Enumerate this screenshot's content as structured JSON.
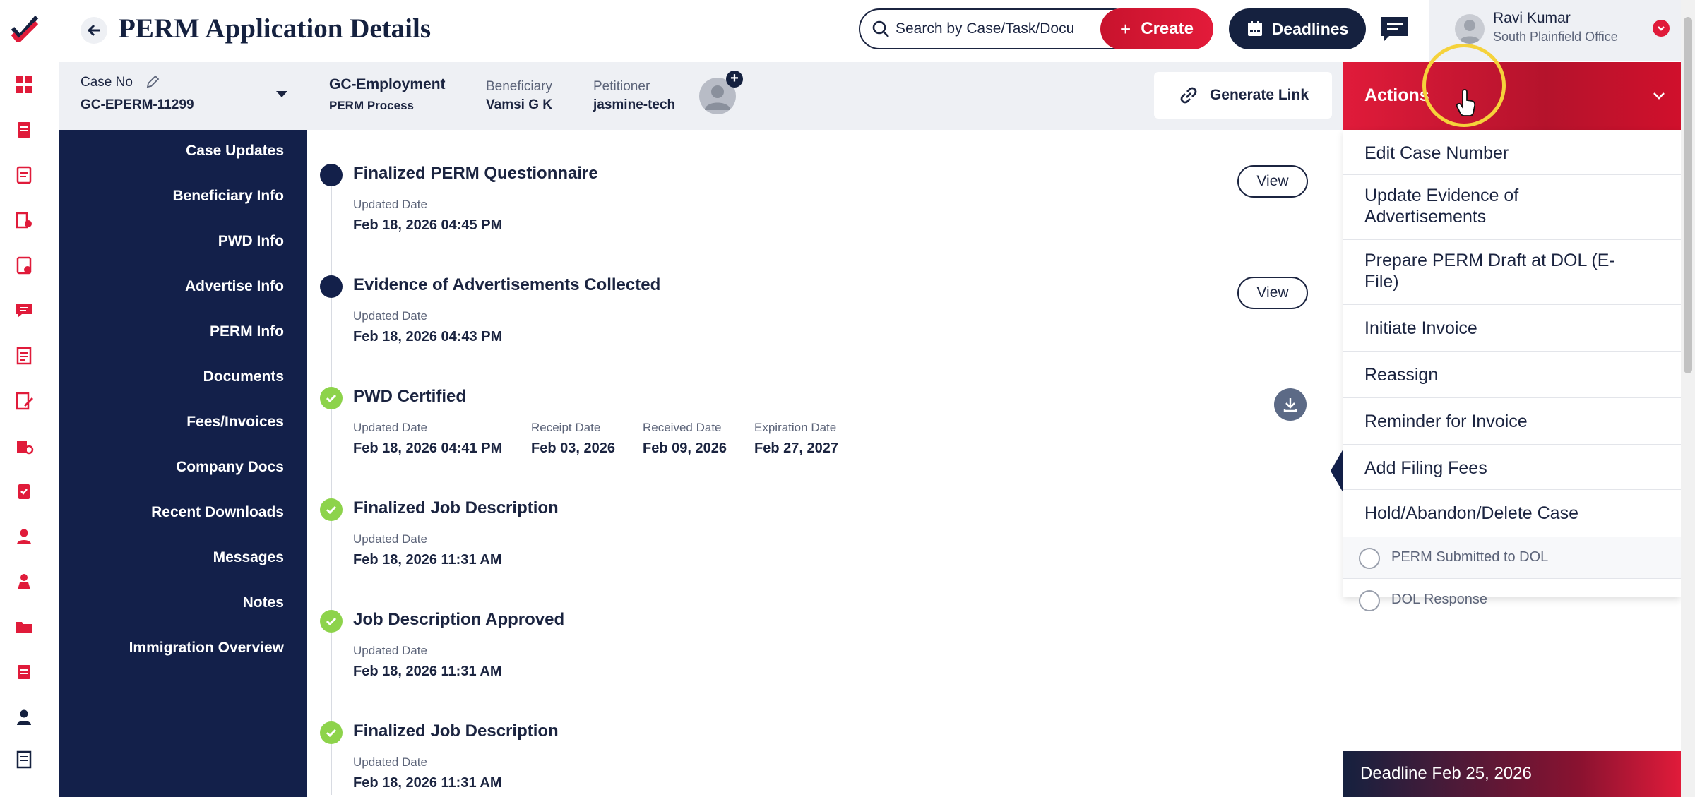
{
  "header": {
    "title": "PERM Application Details",
    "search_placeholder": "Search by Case/Task/Docu",
    "create_label": "Create",
    "deadlines_label": "Deadlines"
  },
  "user": {
    "name": "Ravi Kumar",
    "office": "South Plainfield Office"
  },
  "case": {
    "case_no_label": "Case No",
    "case_no": "GC-EPERM-11299",
    "type_title": "GC-Employment",
    "type_sub": "PERM Process",
    "beneficiary_label": "Beneficiary",
    "beneficiary": "Vamsi G K",
    "petitioner_label": "Petitioner",
    "petitioner": "jasmine-tech",
    "generate_link_label": "Generate Link"
  },
  "nav": {
    "items": [
      {
        "label": "Case Updates"
      },
      {
        "label": "Beneficiary Info"
      },
      {
        "label": "PWD Info"
      },
      {
        "label": "Advertise Info"
      },
      {
        "label": "PERM Info"
      },
      {
        "label": "Documents"
      },
      {
        "label": "Fees/Invoices"
      },
      {
        "label": "Company Docs"
      },
      {
        "label": "Recent Downloads"
      },
      {
        "label": "Messages"
      },
      {
        "label": "Notes"
      },
      {
        "label": "Immigration Overview"
      }
    ]
  },
  "timeline": {
    "updated_label": "Updated Date",
    "view_label": "View",
    "entries": [
      {
        "title": "Finalized PERM Questionnaire",
        "updated": "Feb 18, 2026 04:45 PM",
        "status": "in-progress"
      },
      {
        "title": "Evidence of Advertisements Collected",
        "updated": "Feb 18, 2026 04:43 PM",
        "status": "in-progress"
      },
      {
        "title": "PWD Certified",
        "updated": "Feb 18, 2026 04:41 PM",
        "status": "done",
        "receipt_label": "Receipt Date",
        "receipt": "Feb 03, 2026",
        "received_label": "Received Date",
        "received": "Feb 09, 2026",
        "expiration_label": "Expiration Date",
        "expiration": "Feb 27, 2027"
      },
      {
        "title": "Finalized Job Description",
        "updated": "Feb 18, 2026 11:31 AM",
        "status": "done"
      },
      {
        "title": "Job Description Approved",
        "updated": "Feb 18, 2026 11:31 AM",
        "status": "done"
      },
      {
        "title": "Finalized Job Description",
        "updated": "Feb 18, 2026 11:31 AM",
        "status": "done"
      }
    ]
  },
  "actions": {
    "title": "Actions",
    "menu": [
      {
        "label": "Edit Case Number"
      },
      {
        "label": "Update Evidence of Advertisements"
      },
      {
        "label": "Prepare PERM Draft at DOL (E-File)"
      },
      {
        "label": "Initiate Invoice"
      },
      {
        "label": "Reassign"
      },
      {
        "label": "Reminder for Invoice"
      },
      {
        "label": "Add Filing Fees"
      },
      {
        "label": "Hold/Abandon/Delete Case"
      }
    ],
    "steps": [
      {
        "label": "PERM Submitted to DOL"
      },
      {
        "label": "DOL Response"
      }
    ],
    "deadline": "Deadline Feb 25, 2026"
  },
  "colors": {
    "navy": "#13204a",
    "brand_red": "#e01b3a",
    "success_green": "#8dd34b"
  }
}
